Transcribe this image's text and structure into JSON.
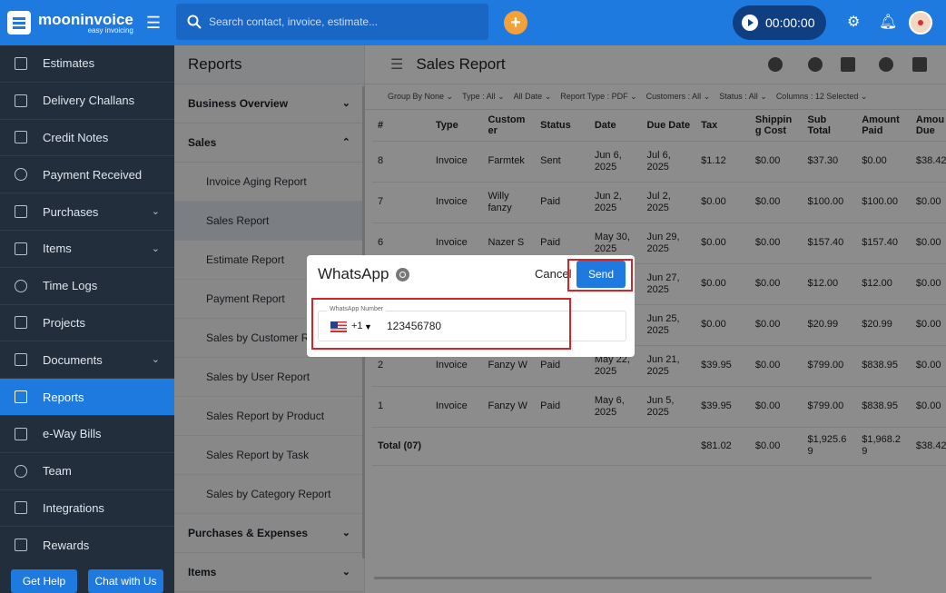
{
  "brand": {
    "name": "mooninvoice",
    "tagline": "easy invoicing"
  },
  "topbar": {
    "search_placeholder": "Search contact, invoice, estimate...",
    "timer": "00:00:00"
  },
  "sidebar": {
    "items": [
      {
        "label": "Estimates",
        "icon": "estimate-icon"
      },
      {
        "label": "Delivery Challans",
        "icon": "delivery-icon"
      },
      {
        "label": "Credit Notes",
        "icon": "credit-note-icon"
      },
      {
        "label": "Payment Received",
        "icon": "payment-icon"
      },
      {
        "label": "Purchases",
        "icon": "purchases-icon",
        "expandable": true
      },
      {
        "label": "Items",
        "icon": "items-icon",
        "expandable": true
      },
      {
        "label": "Time Logs",
        "icon": "clock-icon"
      },
      {
        "label": "Projects",
        "icon": "folder-icon"
      },
      {
        "label": "Documents",
        "icon": "document-icon",
        "expandable": true
      },
      {
        "label": "Reports",
        "icon": "chart-icon",
        "active": true
      },
      {
        "label": "e-Way Bills",
        "icon": "truck-icon"
      },
      {
        "label": "Team",
        "icon": "team-icon"
      },
      {
        "label": "Integrations",
        "icon": "puzzle-icon"
      },
      {
        "label": "Rewards",
        "icon": "gift-icon"
      }
    ],
    "help_label": "Get Help",
    "chat_label": "Chat with Us"
  },
  "reports_panel": {
    "title": "Reports",
    "sections": {
      "business": "Business Overview",
      "sales": "Sales",
      "purchases": "Purchases & Expenses",
      "items": "Items"
    },
    "sales_items": [
      "Invoice Aging Report",
      "Sales Report",
      "Estimate Report",
      "Payment Report",
      "Sales by Customer Report",
      "Sales by User Report",
      "Sales Report by Product",
      "Sales Report by Task",
      "Sales by Category Report"
    ]
  },
  "main": {
    "title": "Sales Report",
    "filters": [
      "Group By None",
      "Type : All",
      "All Date",
      "Report Type : PDF",
      "Customers : All",
      "Status : All",
      "Columns : 12 Selected"
    ],
    "columns": [
      "#",
      "Type",
      "Custom er",
      "Status",
      "Date",
      "Due Date",
      "Tax",
      "Shippin g Cost",
      "Sub Total",
      "Amount Paid",
      "Amou Due"
    ],
    "rows": [
      [
        "8",
        "Invoice",
        "Farmtek",
        "Sent",
        "Jun 6, 2025",
        "Jul 6, 2025",
        "$1.12",
        "$0.00",
        "$37.30",
        "$0.00",
        "$38.42"
      ],
      [
        "7",
        "Invoice",
        "Willy fanzy",
        "Paid",
        "Jun 2, 2025",
        "Jul 2, 2025",
        "$0.00",
        "$0.00",
        "$100.00",
        "$100.00",
        "$0.00"
      ],
      [
        "6",
        "Invoice",
        "Nazer S",
        "Paid",
        "May 30, 2025",
        "Jun 29, 2025",
        "$0.00",
        "$0.00",
        "$157.40",
        "$157.40",
        "$0.00"
      ],
      [
        "",
        "",
        "",
        "",
        "",
        "Jun 27, 2025",
        "$0.00",
        "$0.00",
        "$12.00",
        "$12.00",
        "$0.00"
      ],
      [
        "",
        "",
        "",
        "",
        "",
        "Jun 25, 2025",
        "$0.00",
        "$0.00",
        "$20.99",
        "$20.99",
        "$0.00"
      ],
      [
        "2",
        "Invoice",
        "Fanzy W",
        "Paid",
        "May 22, 2025",
        "Jun 21, 2025",
        "$39.95",
        "$0.00",
        "$799.00",
        "$838.95",
        "$0.00"
      ],
      [
        "1",
        "Invoice",
        "Fanzy W",
        "Paid",
        "May 6, 2025",
        "Jun 5, 2025",
        "$39.95",
        "$0.00",
        "$799.00",
        "$838.95",
        "$0.00"
      ]
    ],
    "total": [
      "Total (07)",
      "",
      "",
      "",
      "",
      "",
      "$81.02",
      "$0.00",
      "$1,925.6 9",
      "$1,968.2 9",
      "$38.42"
    ]
  },
  "modal": {
    "title": "WhatsApp",
    "cancel_label": "Cancel",
    "send_label": "Send",
    "field_label": "WhatsApp Number",
    "country_code": "+1",
    "phone_number": "123456780"
  },
  "colors": {
    "primary": "#1f7ae0",
    "sidebar": "#222e3c",
    "highlight": "#d6232a",
    "accent": "#f5a13a"
  }
}
